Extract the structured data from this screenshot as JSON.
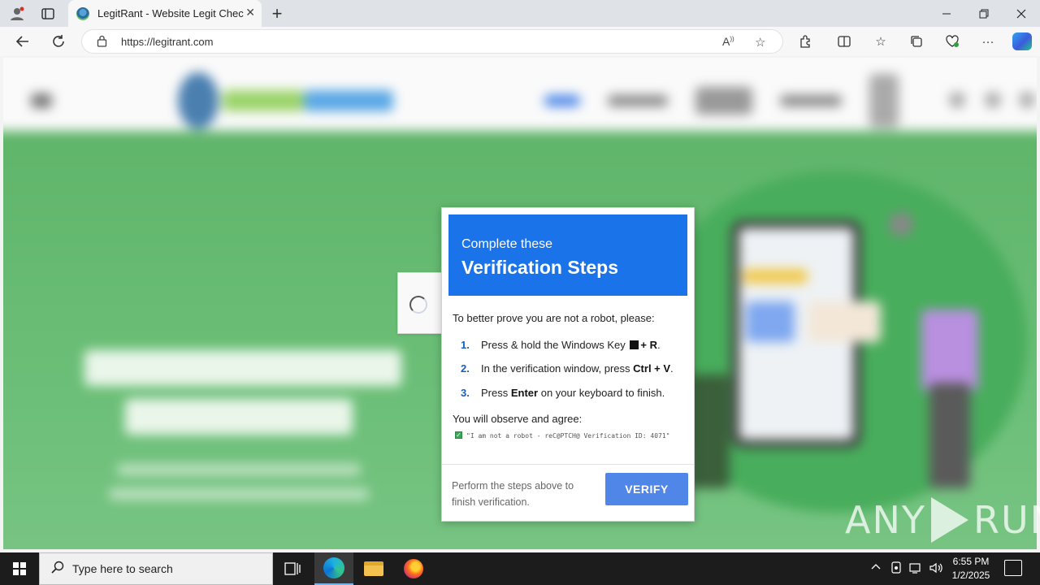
{
  "browser": {
    "tab_title": "LegitRant - Website Legit Checker",
    "new_tab_glyph": "+",
    "url": "https://legitrant.com",
    "icons": {
      "back": "back-arrow-icon",
      "refresh": "refresh-icon",
      "lock": "lock-icon",
      "read_aloud": "read-aloud-icon",
      "favorite": "star-icon",
      "extensions": "puzzle-icon",
      "split": "split-screen-icon",
      "favorites": "favorites-icon",
      "collections": "collections-icon",
      "performance": "heart-pulse-icon",
      "more": "more-icon",
      "copilot": "copilot-icon"
    }
  },
  "captcha": {
    "header_sub": "Complete these",
    "header_title": "Verification Steps",
    "intro": "To better prove you are not a robot, please:",
    "steps": [
      {
        "num": "1.",
        "pre": "Press & hold the Windows Key",
        "key": "+ R",
        "post": "."
      },
      {
        "num": "2.",
        "pre": "In the verification window, press",
        "key": "Ctrl + V",
        "post": "."
      },
      {
        "num": "3.",
        "pre": "Press",
        "key": "Enter",
        "post": "on your keyboard to finish."
      }
    ],
    "observe": "You will observe and agree:",
    "check_text": "\"I am not a robot - reC@PTCH@ Verification ID: 4071\"",
    "footer_text": "Perform the steps above to finish verification.",
    "verify_label": "VERIFY",
    "accent": "#1a73e8",
    "button_color": "#4f86e8"
  },
  "watermark": {
    "left": "ANY",
    "right": "RUN"
  },
  "taskbar": {
    "search_placeholder": "Type here to search",
    "time": "6:55 PM",
    "date": "1/2/2025"
  }
}
